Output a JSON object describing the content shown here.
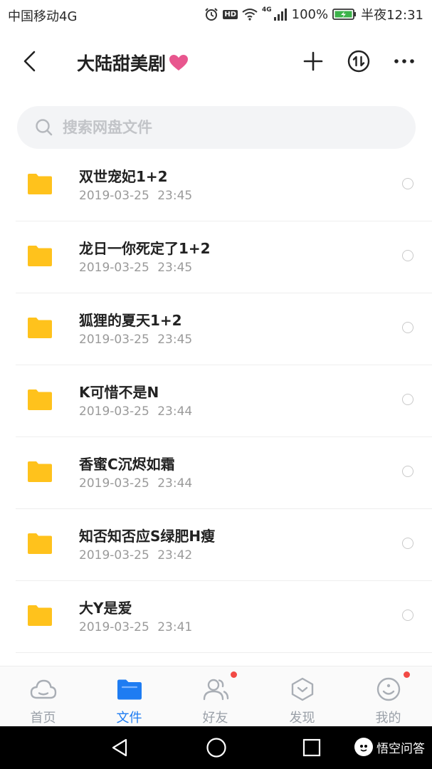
{
  "status_bar": {
    "carrier": "中国移动4G",
    "hd": "HD",
    "net": "4G",
    "battery": "100%",
    "time": "半夜12:31"
  },
  "header": {
    "title": "大陆甜美剧",
    "icons": [
      "back-arrow-icon",
      "heart-icon",
      "plus-icon",
      "transfer-icon",
      "more-icon"
    ]
  },
  "search": {
    "placeholder": "搜索网盘文件",
    "value": ""
  },
  "files": [
    {
      "name": "双世宠妃1+2",
      "date": "2019-03-25",
      "time": "23:45"
    },
    {
      "name": "龙日一你死定了1+2",
      "date": "2019-03-25",
      "time": "23:45"
    },
    {
      "name": "狐狸的夏天1+2",
      "date": "2019-03-25",
      "time": "23:45"
    },
    {
      "name": "K可惜不是N",
      "date": "2019-03-25",
      "time": "23:44"
    },
    {
      "name": "香蜜C沉烬如霜",
      "date": "2019-03-25",
      "time": "23:44"
    },
    {
      "name": "知否知否应S绿肥H瘦",
      "date": "2019-03-25",
      "time": "23:42"
    },
    {
      "name": "大Y是爱",
      "date": "2019-03-25",
      "time": "23:41"
    }
  ],
  "bottom_nav": {
    "items": [
      {
        "label": "首页",
        "icon": "cloud-icon",
        "active": false,
        "badge": false
      },
      {
        "label": "文件",
        "icon": "folder-icon",
        "active": true,
        "badge": false
      },
      {
        "label": "好友",
        "icon": "friends-icon",
        "active": false,
        "badge": true
      },
      {
        "label": "发现",
        "icon": "discover-icon",
        "active": false,
        "badge": false
      },
      {
        "label": "我的",
        "icon": "profile-icon",
        "active": false,
        "badge": true
      }
    ]
  },
  "watermark": "悟空问答",
  "colors": {
    "accent": "#1e7cf2",
    "folder": "#ffc21c",
    "heart": "#e8568e",
    "badge": "#f24a45",
    "battery": "#3cb34a"
  }
}
